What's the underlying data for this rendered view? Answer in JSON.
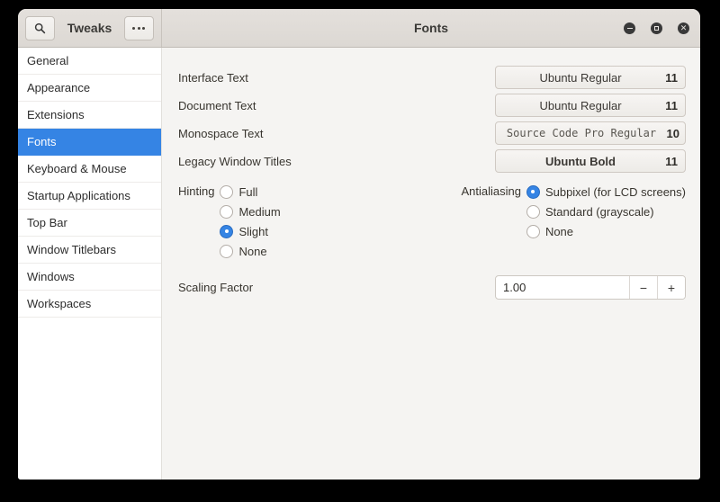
{
  "window": {
    "left_header": {
      "title": "Tweaks"
    },
    "right_header": {
      "title": "Fonts"
    },
    "window_controls": {
      "buttons": [
        "minimize",
        "unmaximize",
        "close"
      ]
    }
  },
  "sidebar": {
    "items": [
      {
        "label": "General",
        "selected": false
      },
      {
        "label": "Appearance",
        "selected": false
      },
      {
        "label": "Extensions",
        "selected": false
      },
      {
        "label": "Fonts",
        "selected": true
      },
      {
        "label": "Keyboard & Mouse",
        "selected": false
      },
      {
        "label": "Startup Applications",
        "selected": false
      },
      {
        "label": "Top Bar",
        "selected": false
      },
      {
        "label": "Window Titlebars",
        "selected": false
      },
      {
        "label": "Windows",
        "selected": false
      },
      {
        "label": "Workspaces",
        "selected": false
      }
    ]
  },
  "content": {
    "font_rows": [
      {
        "label": "Interface Text",
        "font": "Ubuntu Regular",
        "size": "11",
        "style": "regular"
      },
      {
        "label": "Document Text",
        "font": "Ubuntu Regular",
        "size": "11",
        "style": "regular"
      },
      {
        "label": "Monospace Text",
        "font": "Source Code Pro Regular",
        "size": "10",
        "style": "mono"
      },
      {
        "label": "Legacy Window Titles",
        "font": "Ubuntu Bold",
        "size": "11",
        "style": "bold"
      }
    ],
    "hinting": {
      "label": "Hinting",
      "options": [
        {
          "label": "Full",
          "selected": false
        },
        {
          "label": "Medium",
          "selected": false
        },
        {
          "label": "Slight",
          "selected": true
        },
        {
          "label": "None",
          "selected": false
        }
      ]
    },
    "antialiasing": {
      "label": "Antialiasing",
      "options": [
        {
          "label": "Subpixel (for LCD screens)",
          "selected": true
        },
        {
          "label": "Standard (grayscale)",
          "selected": false
        },
        {
          "label": "None",
          "selected": false
        }
      ]
    },
    "scaling": {
      "label": "Scaling Factor",
      "value": "1.00",
      "decrement": "−",
      "increment": "+"
    }
  },
  "colors": {
    "accent": "#3584e4",
    "header_bg": "#e0dcd7",
    "sidebar_bg": "#ffffff",
    "content_bg": "#f5f4f2",
    "surround": "#000000"
  }
}
